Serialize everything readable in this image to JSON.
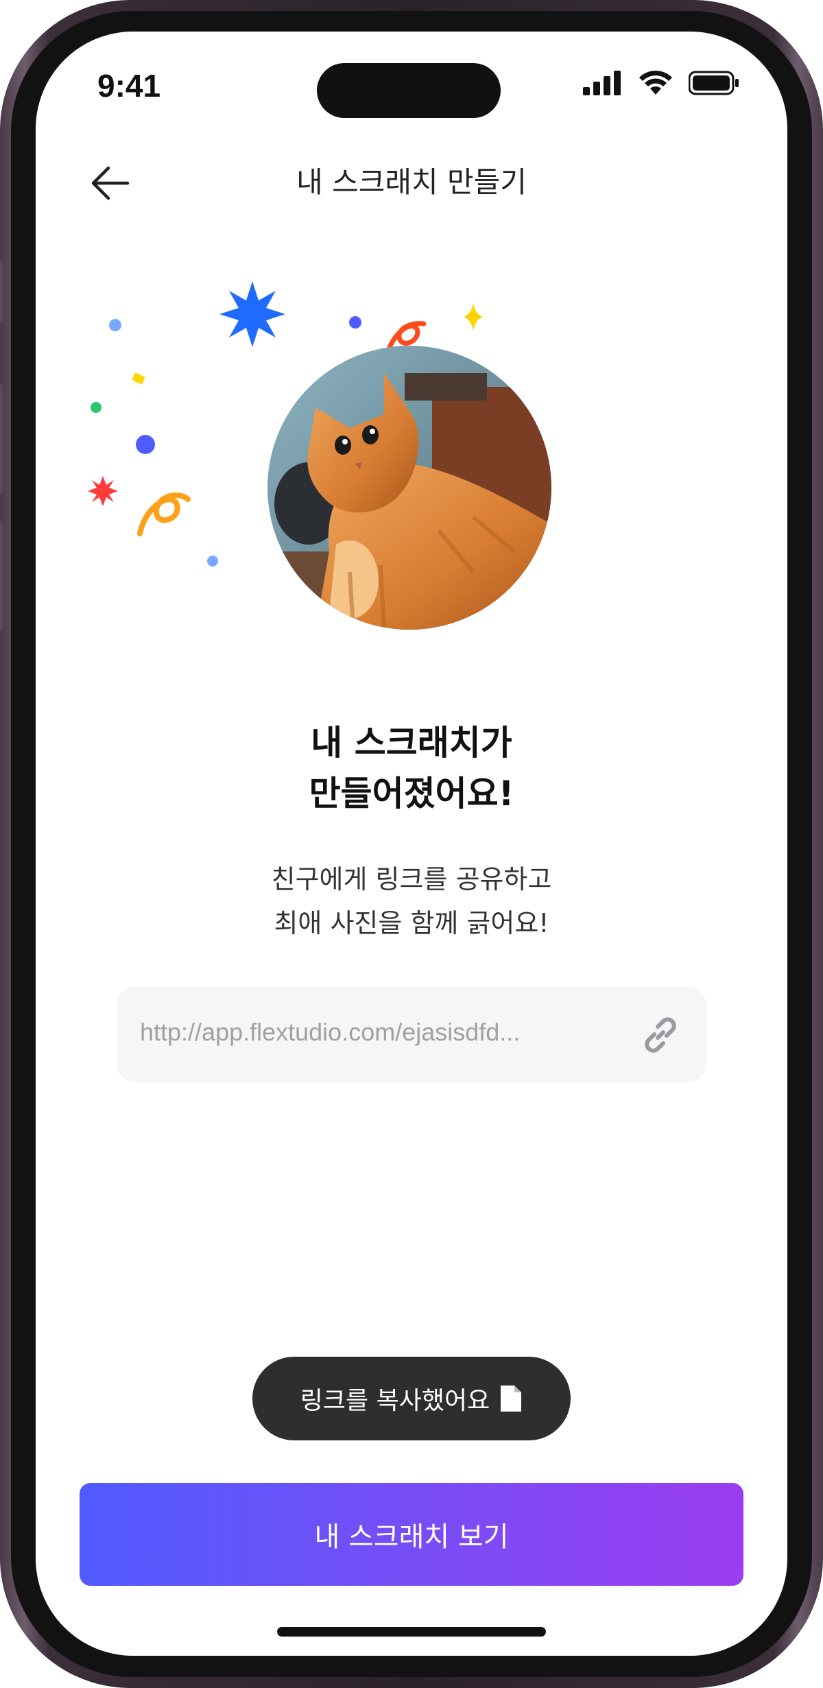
{
  "status_bar": {
    "time": "9:41"
  },
  "header": {
    "title": "내 스크래치 만들기"
  },
  "main": {
    "headline_line1": "내 스크래치가",
    "headline_line2": "만들어졌어요!",
    "subtext_line1": "친구에게 링크를 공유하고",
    "subtext_line2": "최애 사진을 함께 긁어요!",
    "link_url": "http://app.flextudio.com/ejasisdfd..."
  },
  "toast": {
    "label": "링크를 복사했어요"
  },
  "cta": {
    "label": "내 스크래치 보기"
  },
  "colors": {
    "cta_gradient_start": "#4f5bff",
    "cta_gradient_end": "#9a3df0",
    "toast_bg": "#2e2e2e",
    "link_box_bg": "#f6f6f7"
  },
  "icons": {
    "back": "arrow-left-icon",
    "link": "link-chain-icon",
    "toast": "document-icon",
    "signal": "cellular-signal-icon",
    "wifi": "wifi-icon",
    "battery": "battery-icon"
  }
}
